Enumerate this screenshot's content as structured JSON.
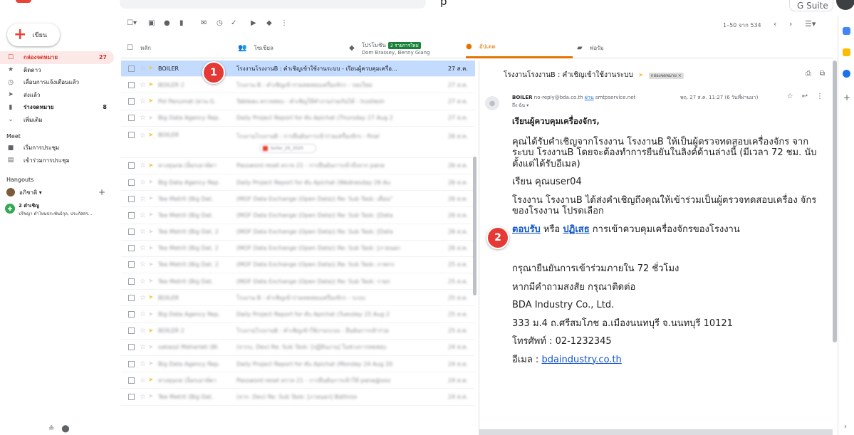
{
  "topbar": {
    "clipped_text": "p",
    "account_label": "G Suite"
  },
  "compose": {
    "label": "เขียน"
  },
  "nav": {
    "items": [
      {
        "icon": "inbox-icon",
        "glyph": "☐",
        "label": "กล่องจดหมาย",
        "count": "27",
        "active": true
      },
      {
        "icon": "star-icon",
        "glyph": "★",
        "label": "ติดดาว",
        "count": ""
      },
      {
        "icon": "clock-icon",
        "glyph": "◷",
        "label": "เลื่อนการแจ้งเตือนแล้ว",
        "count": ""
      },
      {
        "icon": "send-icon",
        "glyph": "➤",
        "label": "ส่งแล้ว",
        "count": ""
      },
      {
        "icon": "draft-icon",
        "glyph": "▮",
        "label": "ร่างจดหมาย",
        "count": "8",
        "bold": true
      },
      {
        "icon": "chevron-down-icon",
        "glyph": "⌄",
        "label": "เพิ่มเติม",
        "count": ""
      }
    ],
    "meet_title": "Meet",
    "meet_items": [
      {
        "icon": "video-icon",
        "glyph": "■",
        "label": "เริ่มการประชุม"
      },
      {
        "icon": "keyboard-icon",
        "glyph": "▤",
        "label": "เข้าร่วมการประชุม"
      }
    ],
    "hangouts_title": "Hangouts",
    "hangouts_user": "อภิชาติ ▾",
    "invite_title": "2 คำเชิญ",
    "invite_sub": "ปรีชญา ดำไหมประพันธ์กุล, ประภัสสร..."
  },
  "toolbar": {
    "pager_text": "1–50 จาก 534"
  },
  "tabs": [
    {
      "icon": "inbox-icon",
      "glyph": "☐",
      "label": "หลัก"
    },
    {
      "icon": "people-icon",
      "glyph": "👥",
      "label": "โซเชียล"
    },
    {
      "icon": "tag-icon",
      "glyph": "◆",
      "label": "โปรโมชัน",
      "badge": "2 รายการใหม่",
      "sub": "Dom Brassey, Benny Giang"
    },
    {
      "icon": "info-icon",
      "glyph": "●",
      "label": "อัปเดต",
      "active": true
    },
    {
      "icon": "forum-icon",
      "glyph": "▰",
      "label": "ฟอรัม"
    }
  ],
  "emails": [
    {
      "sender": "BOILER",
      "subject": "โรงงานโรงงานB : คำเชิญเข้าใช้งานระบบ - เรียนผู้ควบคุมเครื่อ...",
      "date": "27 ส.ค.",
      "selected": true
    },
    {
      "sender": "BOILER 2",
      "subject": "โรงงาน B : คำเชิญเข้าร่วมทดสอบเครื่องจักร - รอบใหม่",
      "date": "27 ส.ค."
    },
    {
      "sender": "Pol Panumat (ผ่าน G.",
      "subject": "Tableau ตรวจสอบ - คำเชิญให้ทำงานร่วมกันได้ - hustlesh",
      "date": "27 ส.ค."
    },
    {
      "sender": "Big Data Agency Rep.",
      "subject": "Daily Project Report for ดับ Apichat (Thursday 27 Aug 2",
      "date": "27 ส.ค."
    },
    {
      "sender": "BOILER",
      "subject": "โรงงานโรงงานB : การยืนยันการเข้าร่วมเครื่องจักร - final",
      "date": "26 ส.ค.",
      "attachment": "boiler_26_2020"
    },
    {
      "sender": "ทางทุนกด (ล็อกเอาท์ตา",
      "subject": "Password reset ตรวจ 21 - การยืนยันการเข้าถึงจาก pana",
      "date": "26 ส.ค."
    },
    {
      "sender": "Big Data Agency Rep.",
      "subject": "Daily Project Report for ดับ Apichat (Wednesday 26 Au",
      "date": "26 ส.ค."
    },
    {
      "sender": "Tee Metrit (Big Dat.",
      "subject": "(MOF Data Exchange (Open Data)) Re: Sub Task: เดือน\"",
      "date": "26 ส.ค."
    },
    {
      "sender": "Tee Metrit (Big Dat.",
      "subject": "(MOF Data Exchange (Open Data)) Re: Sub Task: [Data",
      "date": "26 ส.ค."
    },
    {
      "sender": "Tee Metrit (Big Dat. 2",
      "subject": "(MOF Data Exchange (Open Data)) Re: Sub Task: [Data",
      "date": "26 ส.ค."
    },
    {
      "sender": "Tee Metrit (Big Dat. 2",
      "subject": "(MOF Data Exchange (Open Data)) Re: Sub Task: [ภายนอก",
      "date": "26 ส.ค."
    },
    {
      "sender": "Tee Metrit (Big Dat. 2",
      "subject": "(MOF Data Exchange (Open Data)) Re: Sub Task: ภาคกร",
      "date": "25 ส.ค."
    },
    {
      "sender": "Tee Metrit (Big Dat.",
      "subject": "(MOF Data Exchange (Open Data)) Re: Sub Task: รายก",
      "date": "25 ส.ค."
    },
    {
      "sender": "BOILER",
      "subject": "โรงงาน B : คำเชิญเข้าร่วมทดสอบเครื่องจักร - ระบบ",
      "date": "25 ส.ค."
    },
    {
      "sender": "Big Data Agency Rep.",
      "subject": "Daily Project Report for ดับ Apichat (Tuesday 25 Aug 2",
      "date": "25 ส.ค."
    },
    {
      "sender": "BOILER 2",
      "subject": "โรงงานโรงงานB : คำเชิญเข้าใช้งานระบบ - ยืนยันการเข้าร่วม",
      "date": "25 ส.ค."
    },
    {
      "sender": "sakaozi Maharlati (Bl.",
      "subject": "(จากบ. Dev) Re: Sub Task: [ปฏิทินงาน] ในช่วงการทดสอบ",
      "date": "24 ส.ค."
    },
    {
      "sender": "Big Data Agency Rep.",
      "subject": "Daily Project Report for ดับ Apichat (Monday 24 Aug 20",
      "date": "24 ส.ค."
    },
    {
      "sender": "ทางทุนกด (ล็อกเอาท์ตา",
      "subject": "Password reset ตรวจ 21 - การยืนยันการเข้าใช้ pana@xxx",
      "date": "24 ส.ค."
    },
    {
      "sender": "Tee Metrit (Big Dat.",
      "subject": "(จาก. Dev) Re: Sub Task: [ภายนอก] Bathroo",
      "date": "24 ส.ค."
    }
  ],
  "reader": {
    "subject": "โรงงานโรงงานB : คำเชิญเข้าใช้งานระบบ",
    "label": "กล่องจดหมาย ×",
    "from_name": "BOILER",
    "from_addr": "no-reply@bda.co.th",
    "via_word": "ผ่าน",
    "via_host": "smtpservice.net",
    "to_line": "ถึง ฉัน ▾",
    "date": "พฤ. 27 ส.ค. 11:27 (6 วันที่ผ่านมา)",
    "greeting": "เรียนผู้ควบคุมเครื่องจักร,",
    "p1": "คุณได้รับคำเชิญจากโรงงาน โรงงานB ให้เป็นผู้ตรวจทดสอบเครื่องจักร จากระบบ โรงงานB โดยจะต้องทำการยืนยันในลิงค์ด้านล่างนี้ (มีเวลา 72 ชม. นับตั้งแต่ได้รับอีเมล)",
    "p2": "เรียน คุณuser04",
    "p3": "โรงงาน โรงงานB ได้ส่งคำเชิญถึงคุณให้เข้าร่วมเป็นผู้ตรวจทดสอบเครื่อง จักรของโรงงาน โปรดเลือก",
    "accept": "ตอบรับ",
    "or": " หรือ ",
    "reject": "ปฏิเสธ",
    "p4_tail": " การเข้าควบคุมเครื่องจักรของโรงงาน",
    "p5": "กรุณายืนยันการเข้าร่วมภายใน 72 ชั่วโมง",
    "p6": "หากมีคำถามสงสัย กรุณาติดต่อ",
    "p7": "BDA Industry Co., Ltd.",
    "p8": "333 ม.4 ถ.ศรีสมโภช อ.เมืองนนทบุรี จ.นนทบุรี 10121",
    "p9": "โทรศัพท์ : 02-1232345",
    "email_label": "อีเมล : ",
    "email_link": "bdaindustry.co.th"
  },
  "markers": [
    "1",
    "2"
  ],
  "colors": {
    "accent": "#d93025",
    "selected_row": "#c2dbff",
    "updates_tab": "#e37400",
    "marker": "#e53935"
  }
}
